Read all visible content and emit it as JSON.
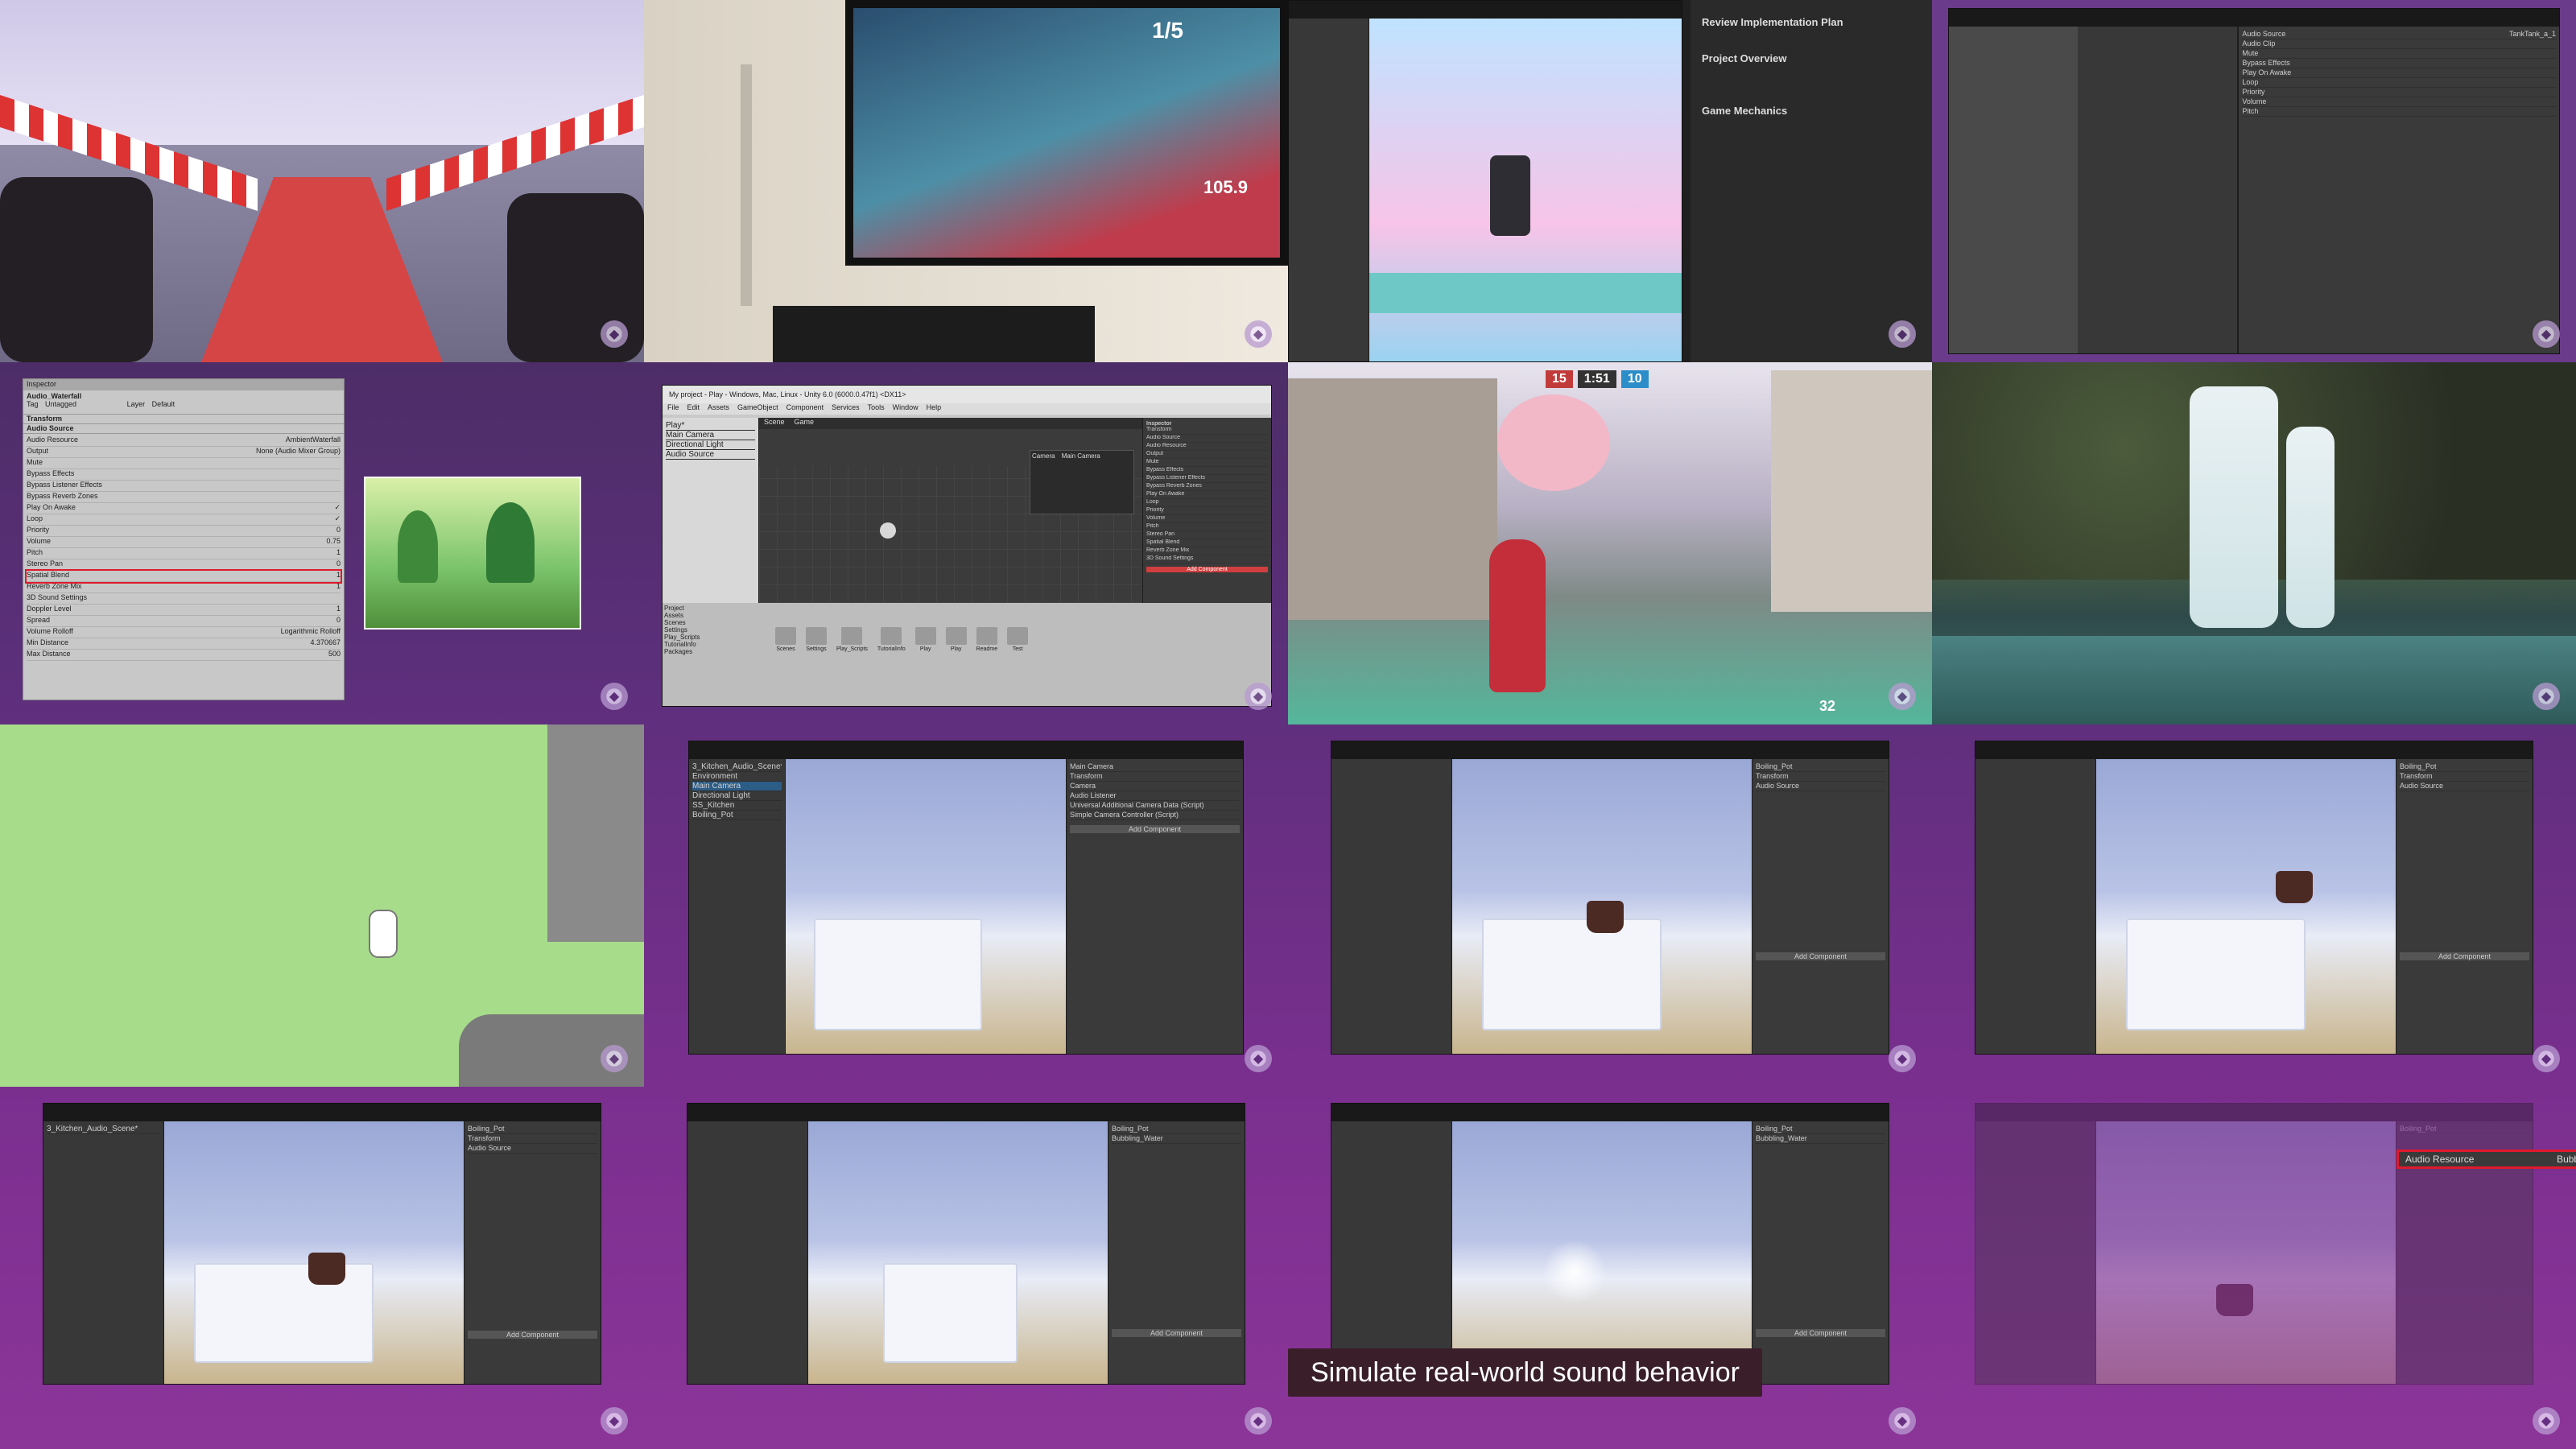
{
  "caption": "Simulate real-world sound behavior",
  "watermark_icon": "microsoft-learn-icon",
  "cells": {
    "c1": {
      "desc": ""
    },
    "c2": {
      "speed_unit": "1/5",
      "speed_value": "105.9"
    },
    "c3": {
      "doc_heading": "Review Implementation Plan",
      "doc_subheading": "Project Overview",
      "doc_section": "Game Mechanics"
    },
    "c4": {
      "field_label": "Audio Source",
      "field_value": "TankTank_a_1",
      "rows": [
        "Audio Clip",
        "Mute",
        "Bypass Effects",
        "Play On Awake",
        "Loop",
        "Priority",
        "Volume",
        "Pitch"
      ]
    },
    "c5": {
      "title": "Inspector",
      "object_name": "Audio_Waterfall",
      "tag_label": "Tag",
      "tag_value": "Untagged",
      "layer_label": "Layer",
      "layer_value": "Default",
      "components": [
        "Transform",
        "Audio Source"
      ],
      "rows": [
        {
          "label": "Audio Resource",
          "value": "AmbientWaterfall"
        },
        {
          "label": "Output",
          "value": "None (Audio Mixer Group)"
        },
        {
          "label": "Mute",
          "value": ""
        },
        {
          "label": "Bypass Effects",
          "value": ""
        },
        {
          "label": "Bypass Listener Effects",
          "value": ""
        },
        {
          "label": "Bypass Reverb Zones",
          "value": ""
        },
        {
          "label": "Play On Awake",
          "value": "✓"
        },
        {
          "label": "Loop",
          "value": "✓"
        },
        {
          "label": "Priority",
          "value": "0"
        },
        {
          "label": "Volume",
          "value": "0.75"
        },
        {
          "label": "Pitch",
          "value": "1"
        },
        {
          "label": "Stereo Pan",
          "value": "0"
        },
        {
          "label": "Spatial Blend",
          "value": "1"
        },
        {
          "label": "Reverb Zone Mix",
          "value": "1"
        },
        {
          "label": "3D Sound Settings",
          "value": ""
        },
        {
          "label": "Doppler Level",
          "value": "1"
        },
        {
          "label": "Spread",
          "value": "0"
        },
        {
          "label": "Volume Rolloff",
          "value": "Logarithmic Rolloff"
        },
        {
          "label": "Min Distance",
          "value": "4.370667"
        },
        {
          "label": "Max Distance",
          "value": "500"
        }
      ]
    },
    "c6": {
      "title": "My project - Play - Windows, Mac, Linux - Unity 6.0 (6000.0.47f1) <DX11>",
      "menu": [
        "File",
        "Edit",
        "Assets",
        "GameObject",
        "Component",
        "Services",
        "Tools",
        "Window",
        "Help"
      ],
      "hierarchy": [
        "Play*",
        "Main Camera",
        "Directional Light",
        "Audio Source"
      ],
      "tabs": [
        "Scene",
        "Game"
      ],
      "inspector_title": "Inspector",
      "inspector_rows": [
        "Transform",
        "Audio Source",
        "Audio Resource",
        "Output",
        "Mute",
        "Bypass Effects",
        "Bypass Listener Effects",
        "Bypass Reverb Zones",
        "Play On Awake",
        "Loop",
        "Priority",
        "Volume",
        "Pitch",
        "Stereo Pan",
        "Spatial Blend",
        "Reverb Zone Mix",
        "3D Sound Settings"
      ],
      "add_component": "Add Component",
      "project_tabs": [
        "Project",
        "Console"
      ],
      "folders": [
        "Assets",
        "Scenes",
        "Settings",
        "Play_Scripts",
        "TutorialInfo",
        "Packages"
      ],
      "asset_items": [
        "Scenes",
        "Settings",
        "Play_Scripts",
        "TutorialInfo",
        "Play",
        "Play",
        "Readme",
        "Test"
      ],
      "camera_label": "Camera",
      "camera_value": "Main Camera"
    },
    "c7": {
      "score_left": "15",
      "score_mid": "1:51",
      "score_right": "10",
      "ammo": "32"
    },
    "c8": {},
    "c9": {},
    "c10": {
      "hierarchy_root": "3_Kitchen_Audio_Scene*",
      "hierarchy": [
        "Environment",
        "Main Camera",
        "Directional Light",
        "SS_Kitchen",
        "Boiling_Pot"
      ],
      "inspector_name": "Main Camera",
      "components": [
        "Transform",
        "Camera",
        "Audio Listener",
        "Universal Additional Camera Data (Script)",
        "Simple Camera Controller (Script)"
      ],
      "add_component": "Add Component"
    },
    "c11": {
      "inspector_name": "Boiling_Pot",
      "components": [
        "Transform",
        "Audio Source"
      ],
      "add_component": "Add Component"
    },
    "c12": {
      "inspector_name": "Boiling_Pot",
      "components": [
        "Transform",
        "Audio Source"
      ],
      "add_component": "Add Component"
    },
    "c13": {
      "inspector_name": "Boiling_Pot",
      "components": [
        "Transform",
        "Audio Source"
      ],
      "add_component": "Add Component",
      "hierarchy_root": "3_Kitchen_Audio_Scene*"
    },
    "c14": {
      "inspector_name": "Boiling_Pot",
      "audio_resource_value": "Bubbling_Water",
      "add_component": "Add Component"
    },
    "c15": {
      "inspector_name": "Boiling_Pot",
      "audio_resource_value": "Bubbling_Water",
      "add_component": "Add Component"
    },
    "c16": {
      "highlight_label": "Audio Resource",
      "highlight_value": "Bubbling_Water",
      "inspector_name": "Boiling_Pot"
    }
  }
}
